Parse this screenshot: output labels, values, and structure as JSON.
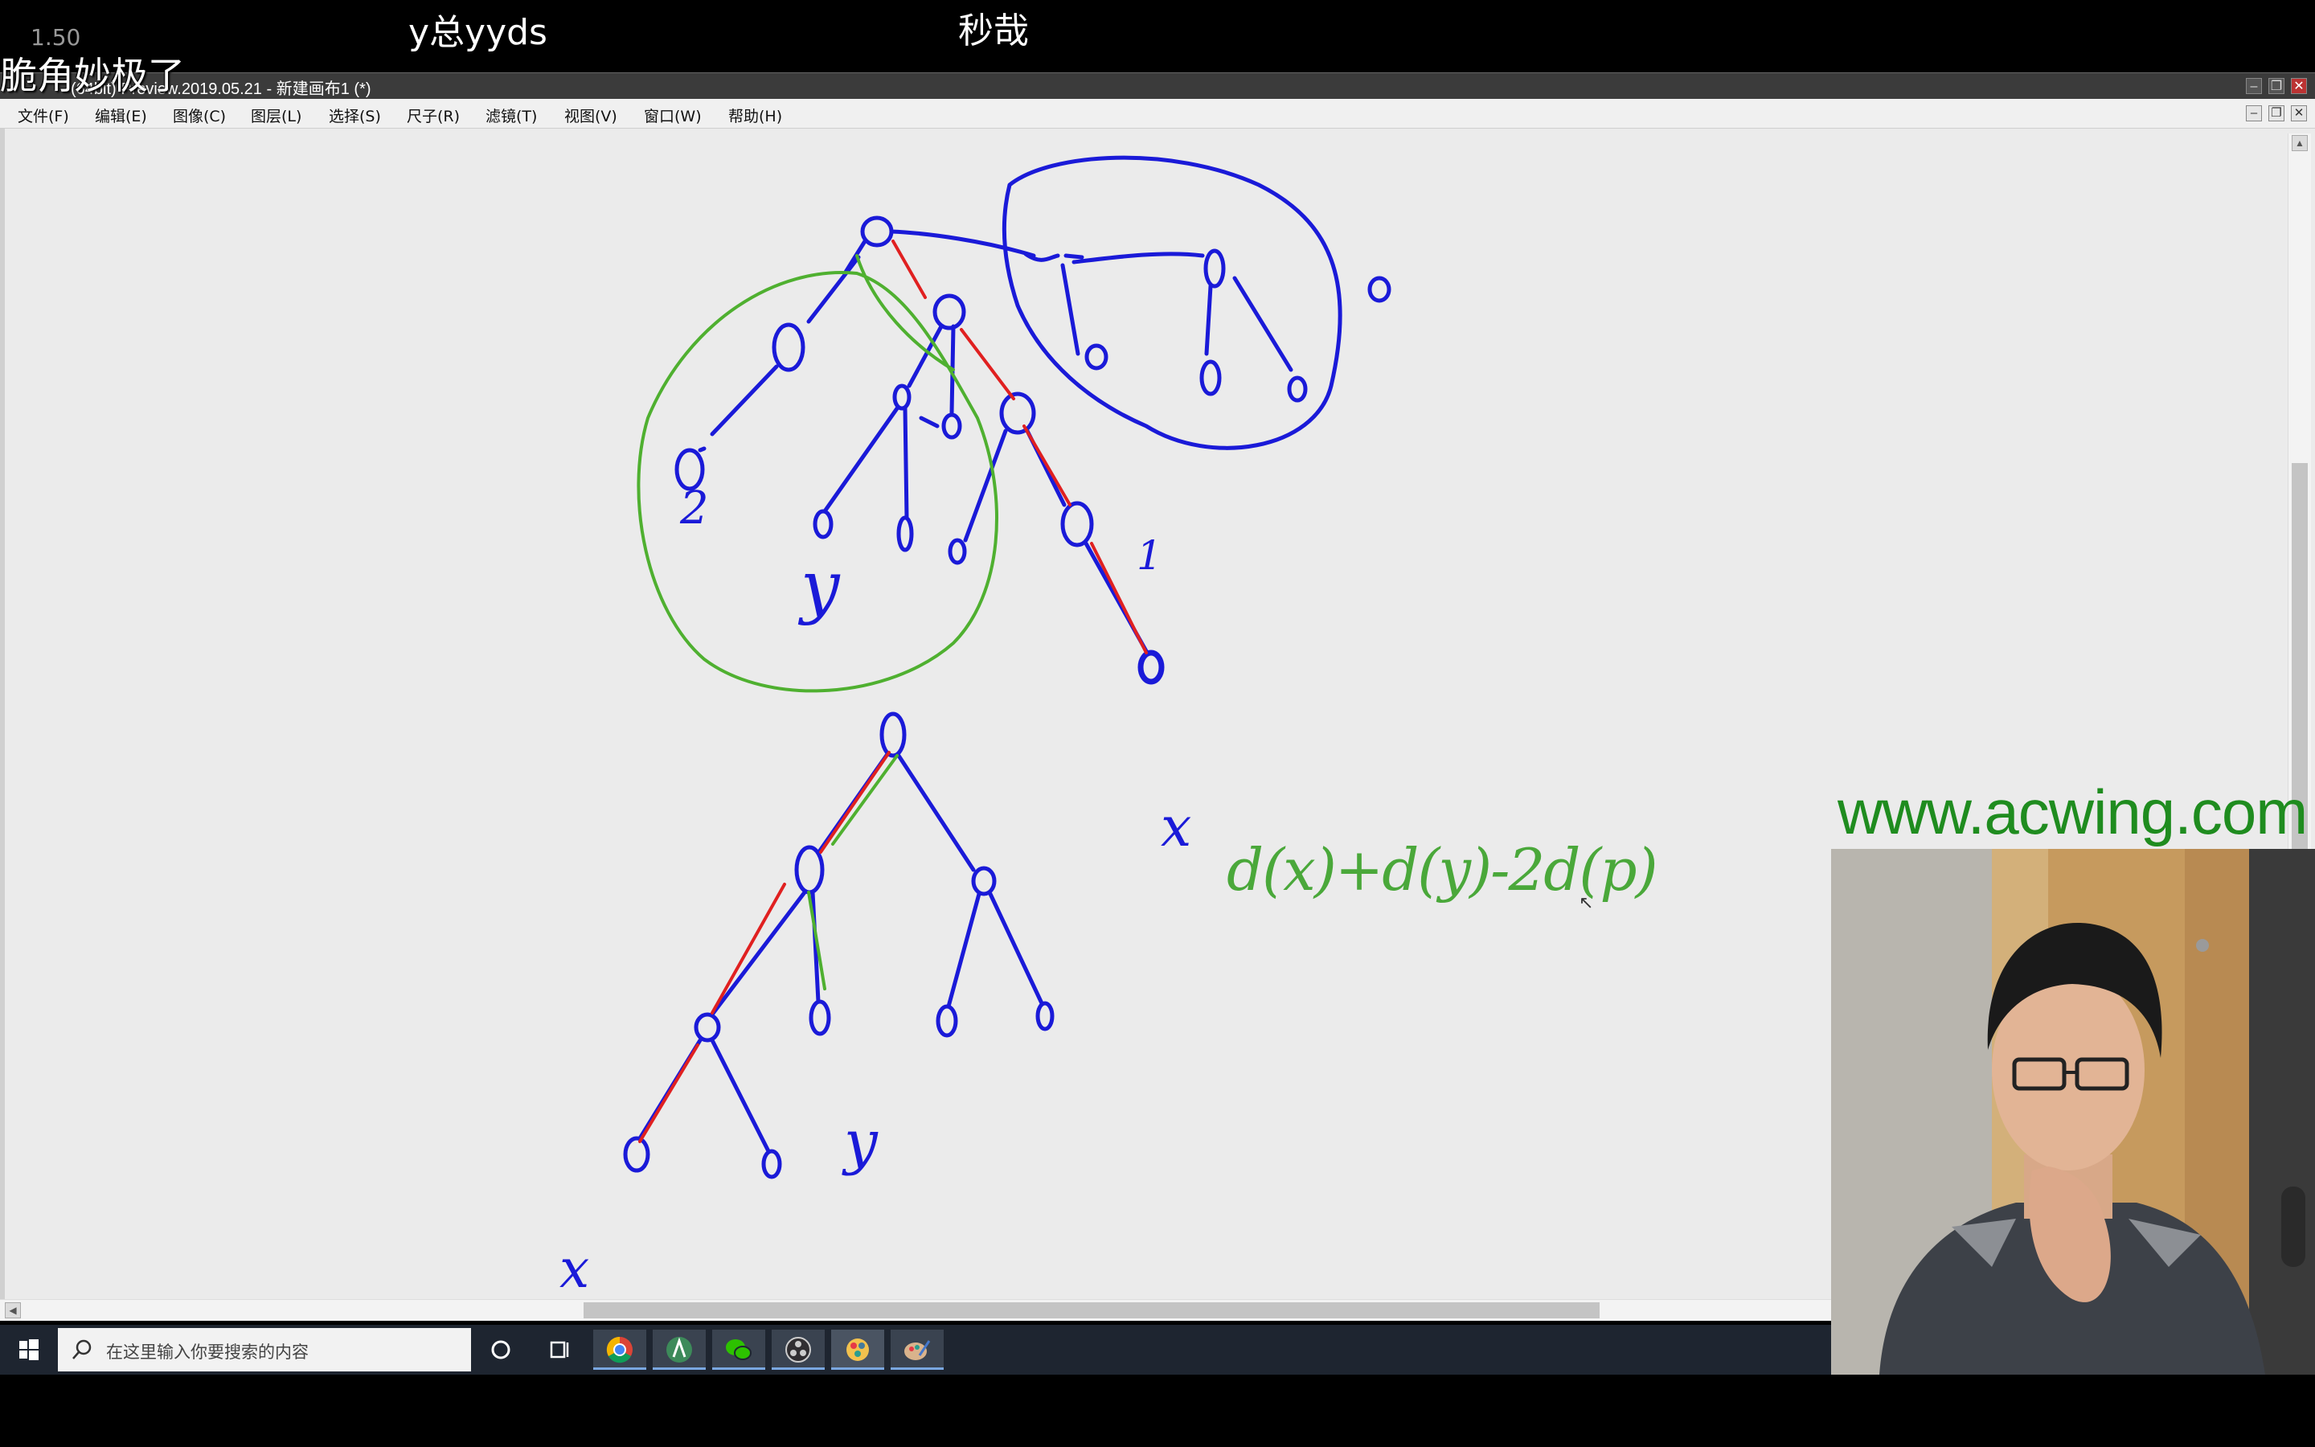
{
  "overlay": {
    "speed": "1.50",
    "danmaku": [
      "y总yyds",
      "秒哉",
      "脆角妙极了"
    ]
  },
  "window": {
    "title": "(64bit) Preview.2019.05.21 - 新建画布1 (*)",
    "controls": [
      "minimize-icon",
      "restore-icon",
      "close-icon"
    ]
  },
  "menubar": {
    "items": [
      "文件(F)",
      "编辑(E)",
      "图像(C)",
      "图层(L)",
      "选择(S)",
      "尺子(R)",
      "滤镜(T)",
      "视图(V)",
      "窗口(W)",
      "帮助(H)"
    ]
  },
  "canvas": {
    "annotations": {
      "label_2": "2",
      "label_y_top": "y",
      "label_1": "1",
      "label_0_right": "0",
      "label_x_top": "x",
      "label_y_bottom": "y",
      "label_x_bottom": "x",
      "formula": "d(x)+d(y)-2d(p)"
    },
    "colors": {
      "background": "#ebebeb",
      "ink_blue": "#1a1ad8",
      "ink_green": "#4fb030",
      "ink_red": "#e02020",
      "formula_green": "#4aa83a"
    }
  },
  "taskbar": {
    "search_placeholder": "在这里输入你要搜索的内容",
    "icons": [
      "windows-start-icon",
      "search-icon",
      "cortana-icon",
      "task-view-icon",
      "chrome-icon",
      "android-studio-icon",
      "wechat-icon",
      "obs-icon",
      "paint-app-icon",
      "paint-tool-icon"
    ]
  },
  "watermark": "www.acwing.com",
  "webcam": {
    "description_icon": "webcam-feed"
  }
}
